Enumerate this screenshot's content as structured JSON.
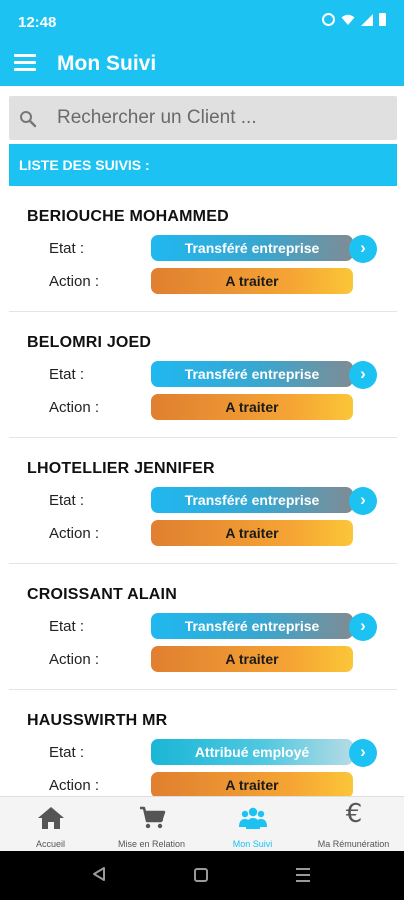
{
  "status_bar": {
    "time": "12:48"
  },
  "app_bar": {
    "title": "Mon Suivi"
  },
  "search": {
    "placeholder": "Rechercher un Client ..."
  },
  "list_header": "LISTE DES SUIVIS :",
  "labels": {
    "etat": "Etat :",
    "action": "Action :"
  },
  "clients": [
    {
      "name": "BERIOUCHE MOHAMMED",
      "etat": "Transféré entreprise",
      "action": "A traiter"
    },
    {
      "name": "BELOMRI JOED",
      "etat": "Transféré entreprise",
      "action": "A traiter"
    },
    {
      "name": "LHOTELLIER JENNIFER",
      "etat": "Transféré entreprise",
      "action": "A traiter"
    },
    {
      "name": "CROISSANT ALAIN",
      "etat": "Transféré entreprise",
      "action": "A traiter"
    },
    {
      "name": "HAUSSWIRTH MR",
      "etat": "Attribué employé",
      "action": "A traiter"
    }
  ],
  "bottom_nav": [
    {
      "label": "Accueil",
      "icon": "home-icon"
    },
    {
      "label": "Mise en Relation",
      "icon": "cart-icon"
    },
    {
      "label": "Mon Suivi",
      "icon": "people-icon",
      "active": true
    },
    {
      "label": "Ma Rémunération",
      "icon": "euro-icon"
    }
  ],
  "nav_euro_symbol": "€",
  "arrow_glyph": "›",
  "colors": {
    "primary": "#1cc2f2",
    "action_orange": "#f5a534"
  }
}
